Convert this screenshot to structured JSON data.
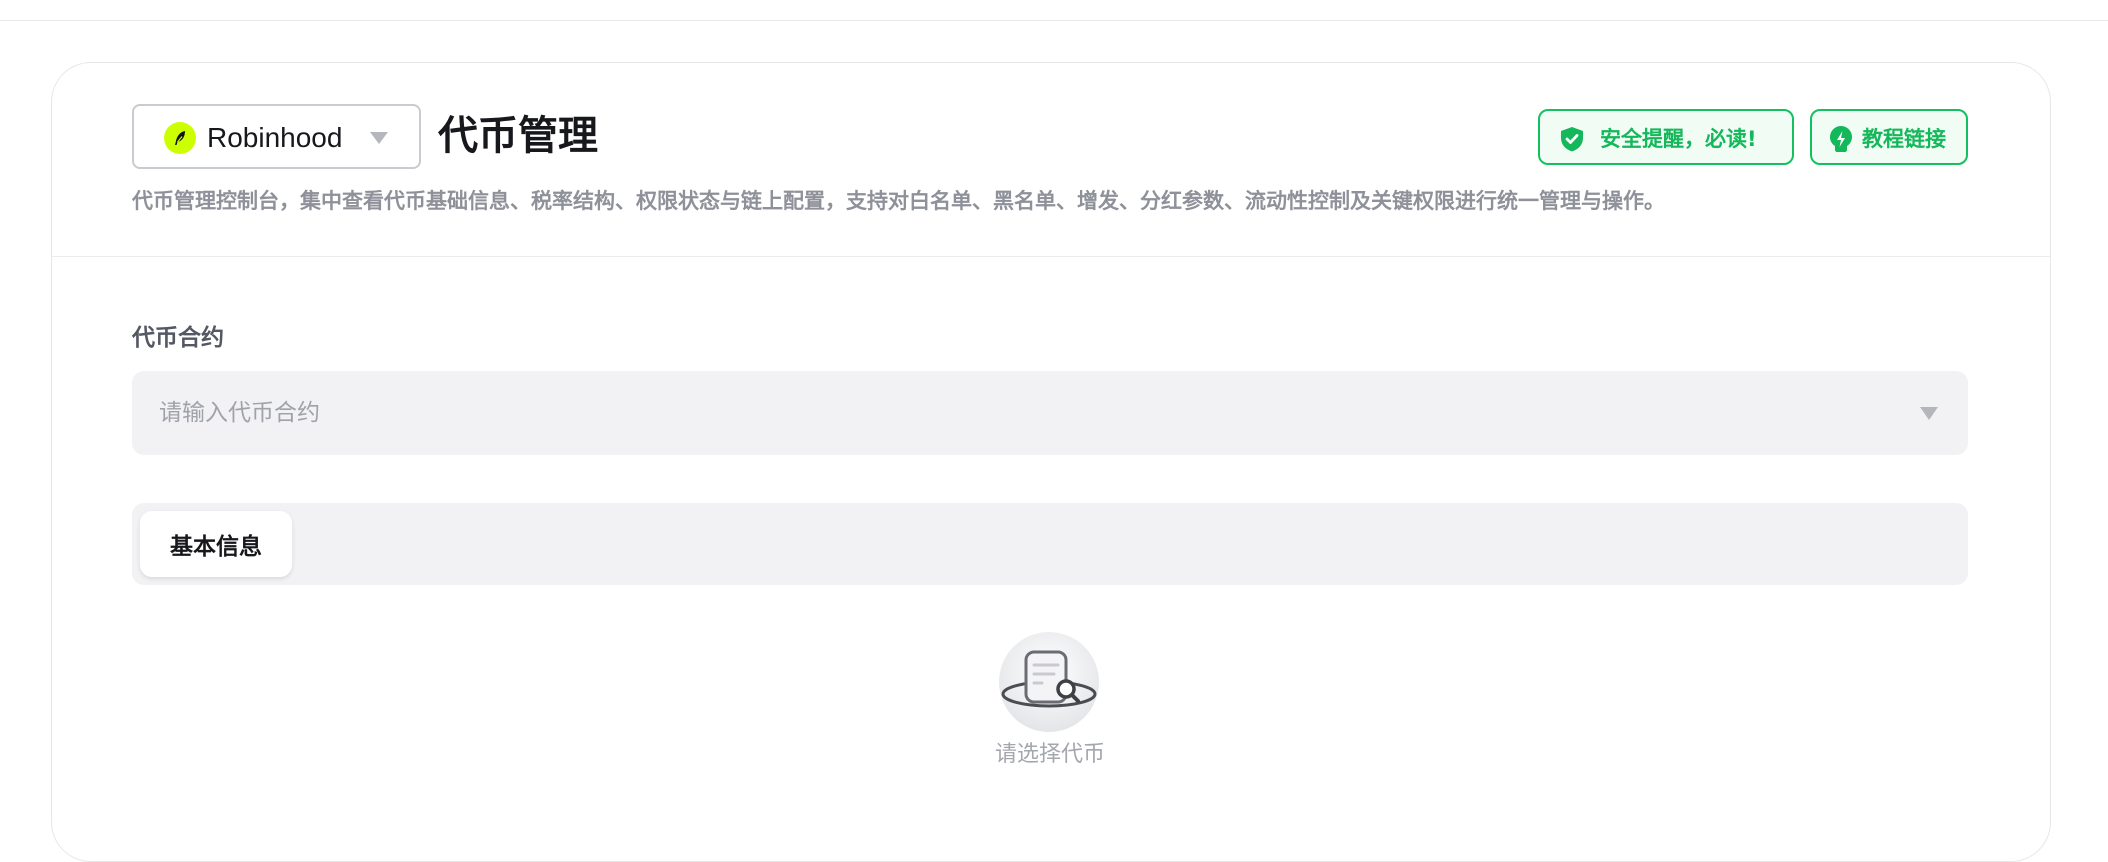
{
  "header": {
    "chain_selector": {
      "label": "Robinhood",
      "icon": "feather-icon",
      "icon_bg_color": "#ccff00"
    },
    "title": "代币管理",
    "description": "代币管理控制台，集中查看代币基础信息、税率结构、权限状态与链上配置，支持对白名单、黑名单、增发、分红参数、流动性控制及关键权限进行统一管理与操作。",
    "buttons": {
      "safety_notice": {
        "label": "安全提醒，必读!",
        "icon": "shield-check-icon"
      },
      "tutorial_link": {
        "label": "教程链接",
        "icon": "lightning-bolt-icon"
      }
    },
    "accent_color": "#14c05f"
  },
  "contract_field": {
    "label": "代币合约",
    "placeholder": "请输入代币合约"
  },
  "tabs": [
    {
      "label": "基本信息",
      "active": true
    }
  ],
  "empty_state": {
    "icon": "document-search-icon",
    "message": "请选择代币"
  }
}
